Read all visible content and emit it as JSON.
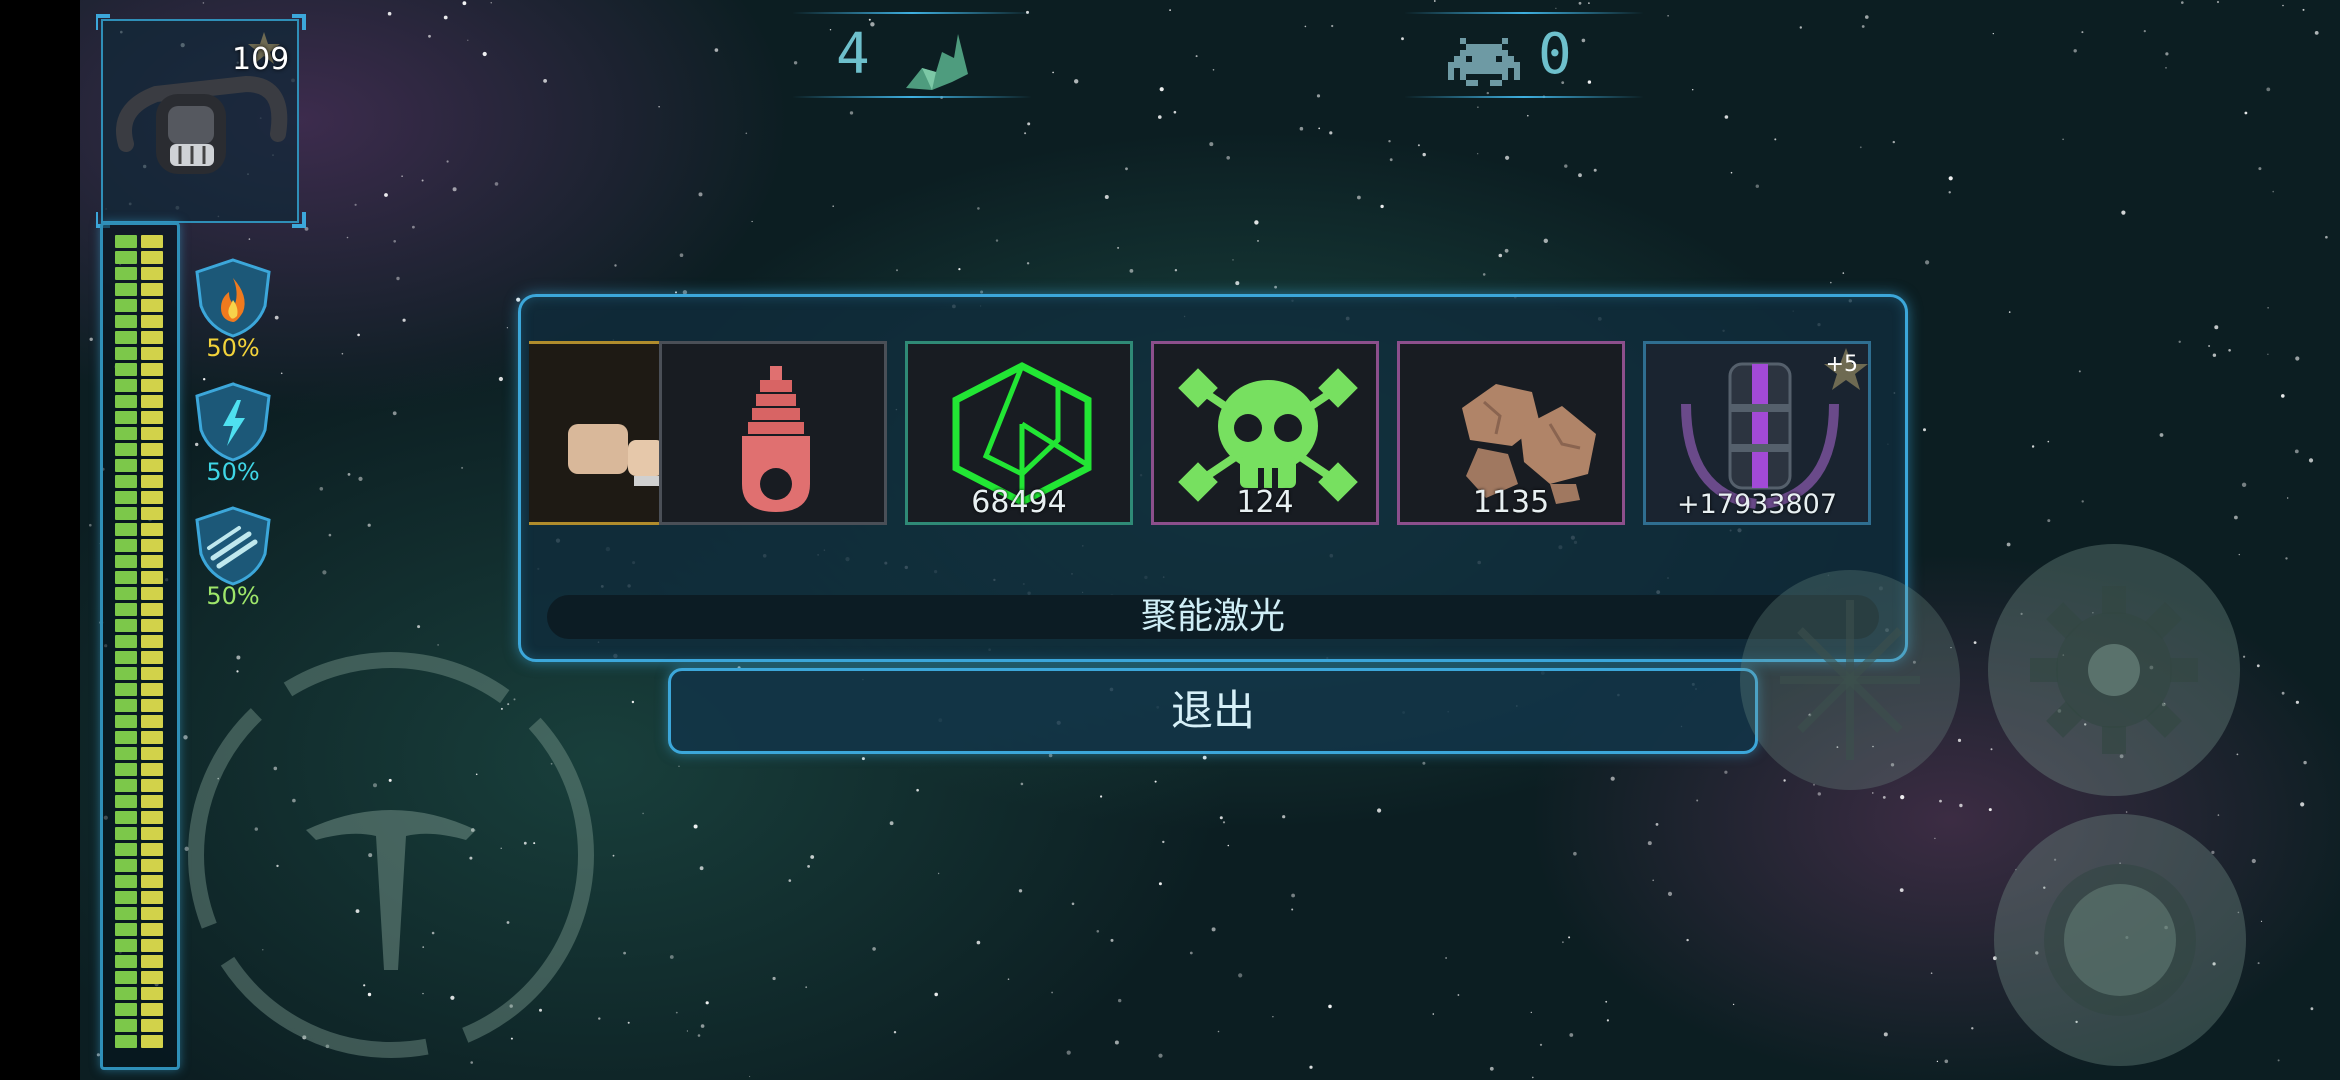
{
  "player": {
    "level": "109"
  },
  "resistances": [
    {
      "icon": "fire-shield-icon",
      "value": "50%",
      "color": "#f2d23a"
    },
    {
      "icon": "lightning-shield-icon",
      "value": "50%",
      "color": "#3fd6e6"
    },
    {
      "icon": "missile-shield-icon",
      "value": "50%",
      "color": "#9ee66a"
    }
  ],
  "counters": {
    "wave": "4",
    "enemies": "0"
  },
  "reward_dialog": {
    "items": [
      {
        "name": "partial-item",
        "count": "",
        "border": "#b08c2c"
      },
      {
        "name": "red-part",
        "count": "",
        "border": "#4a4f57"
      },
      {
        "name": "crystal-currency",
        "count": "68494",
        "border": "#2f8a76"
      },
      {
        "name": "skull-token",
        "count": "124",
        "border": "#8c4f8c"
      },
      {
        "name": "asteroid-ore",
        "count": "1135",
        "border": "#8c4f8c"
      },
      {
        "name": "laser-cannon",
        "count": "+17933807",
        "border": "#2f6e90",
        "badge": "+5"
      }
    ],
    "weapon_name": "聚能激光",
    "exit_label": "退出"
  },
  "colors": {
    "accent": "#3ca7da",
    "health_green": "#7cc84a",
    "health_yellow": "#d2d24a"
  }
}
